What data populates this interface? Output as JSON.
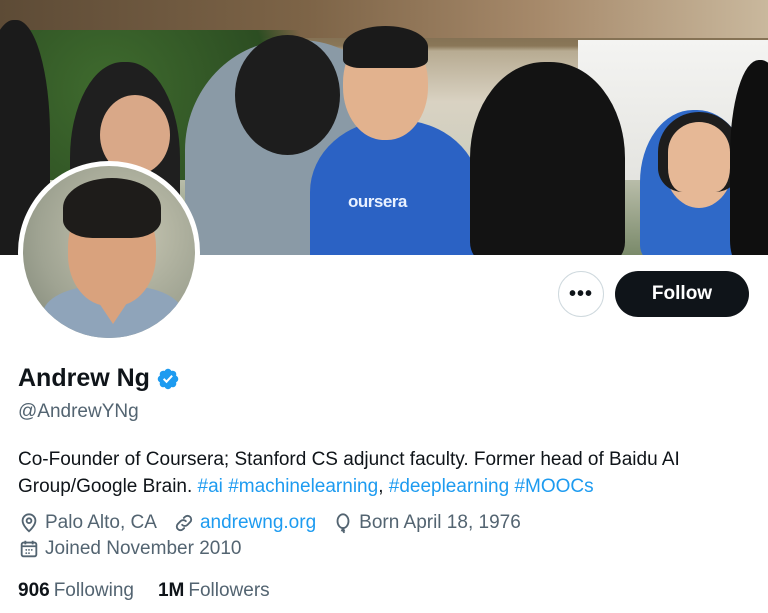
{
  "banner": {
    "photo_text": "oursera"
  },
  "profile": {
    "name": "Andrew Ng",
    "handle": "@AndrewYNg",
    "bio_text": "Co-Founder of Coursera; Stanford CS adjunct faculty. Former head of Baidu AI Group/Google Brain.",
    "hashtags": [
      "#ai",
      "#machinelearning",
      "#deeplearning",
      "#MOOCs"
    ],
    "location": "Palo Alto, CA",
    "website": "andrewng.org",
    "birthday": "Born April 18, 1976",
    "joined": "Joined November 2010"
  },
  "actions": {
    "more_label": "•••",
    "follow_label": "Follow"
  },
  "stats": {
    "following_count": "906",
    "following_label": "Following",
    "followers_count": "1M",
    "followers_label": "Followers"
  },
  "icons": {
    "verified": "verified-badge-icon",
    "location": "location-pin-icon",
    "link": "link-icon",
    "birthday": "balloon-icon",
    "joined": "calendar-icon"
  },
  "colors": {
    "accent": "#1d9bf0",
    "text": "#0f1419",
    "muted": "#536471",
    "button": "#0f1419"
  }
}
